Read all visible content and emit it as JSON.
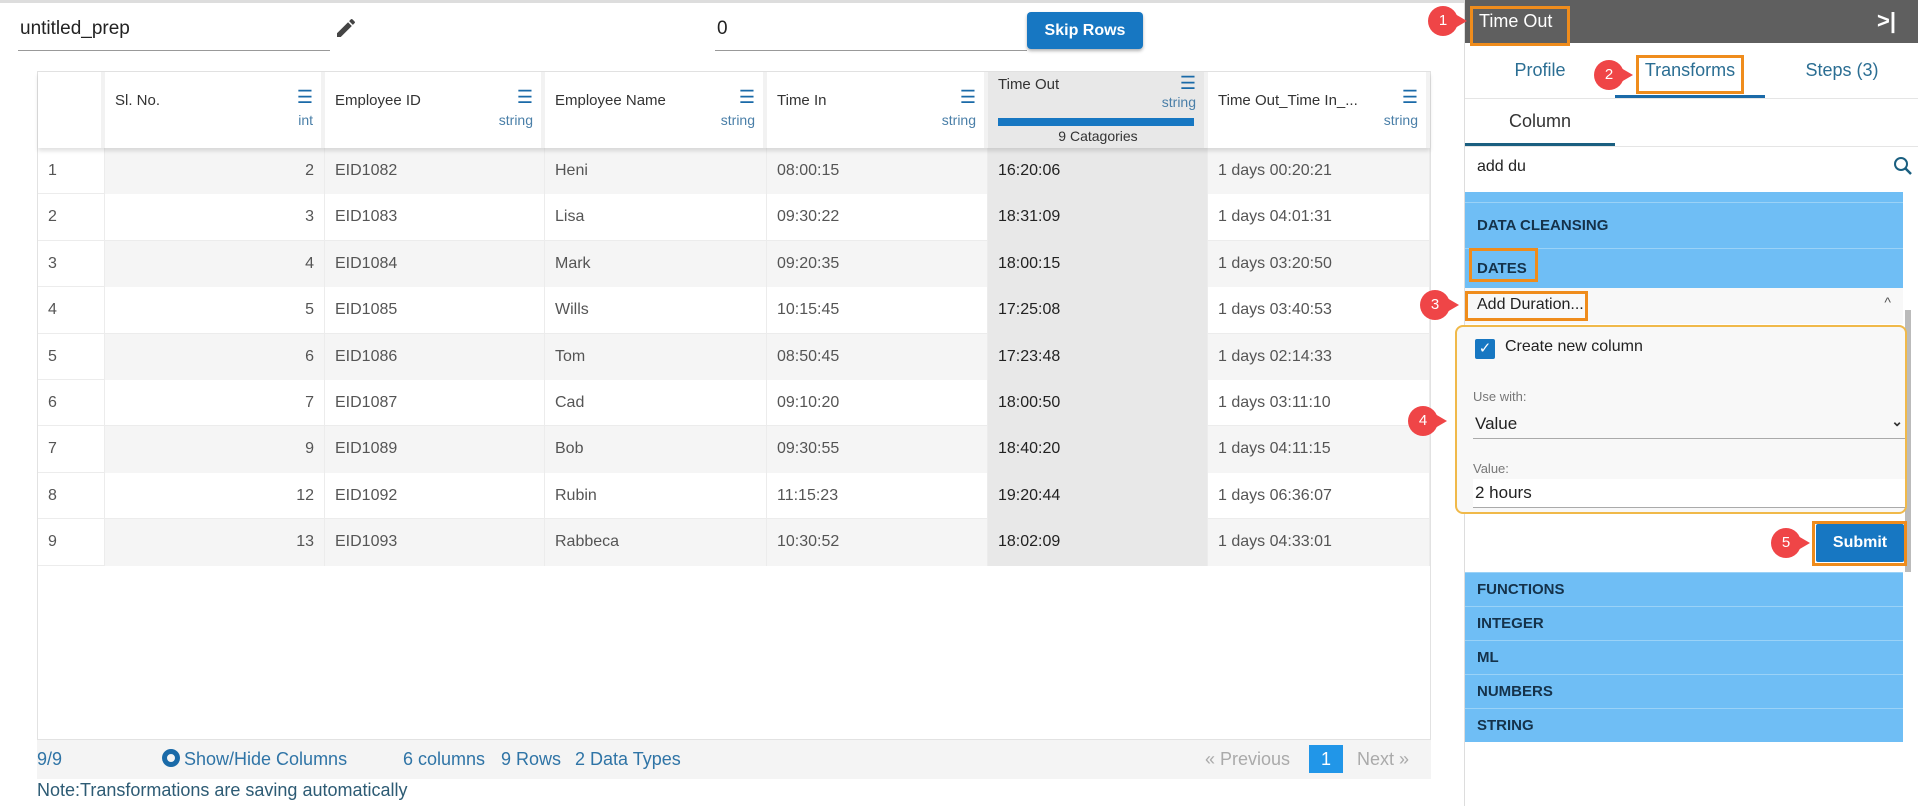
{
  "top": {
    "title_value": "untitled_prep",
    "skip_value": "0",
    "skip_button": "Skip Rows"
  },
  "table": {
    "columns": [
      {
        "label": "Sl. No.",
        "type": "int"
      },
      {
        "label": "Employee ID",
        "type": "string"
      },
      {
        "label": "Employee Name",
        "type": "string"
      },
      {
        "label": "Time In",
        "type": "string"
      },
      {
        "label": "Time Out",
        "type": "string",
        "categories": "9 Catagories"
      },
      {
        "label": "Time Out_Time In_...",
        "type": "string"
      }
    ],
    "rows": [
      [
        "1",
        "2",
        "EID1082",
        "Heni",
        "08:00:15",
        "16:20:06",
        "1 days 00:20:21"
      ],
      [
        "2",
        "3",
        "EID1083",
        "Lisa",
        "09:30:22",
        "18:31:09",
        "1 days 04:01:31"
      ],
      [
        "3",
        "4",
        "EID1084",
        "Mark",
        "09:20:35",
        "18:00:15",
        "1 days 03:20:50"
      ],
      [
        "4",
        "5",
        "EID1085",
        "Wills",
        "10:15:45",
        "17:25:08",
        "1 days 03:40:53"
      ],
      [
        "5",
        "6",
        "EID1086",
        "Tom",
        "08:50:45",
        "17:23:48",
        "1 days 02:14:33"
      ],
      [
        "6",
        "7",
        "EID1087",
        "Cad",
        "09:10:20",
        "18:00:50",
        "1 days 03:11:10"
      ],
      [
        "7",
        "9",
        "EID1089",
        "Bob",
        "09:30:55",
        "18:40:20",
        "1 days 04:11:15"
      ],
      [
        "8",
        "12",
        "EID1092",
        "Rubin",
        "11:15:23",
        "19:20:44",
        "1 days 06:36:07"
      ],
      [
        "9",
        "13",
        "EID1093",
        "Rabbeca",
        "10:30:52",
        "18:02:09",
        "1 days 04:33:01"
      ]
    ]
  },
  "footer": {
    "count": "9/9",
    "show_hide": "Show/Hide Columns",
    "columns": "6 columns",
    "rows": "9 Rows",
    "types": "2 Data Types",
    "previous": "« Previous",
    "page": "1",
    "next": "Next »"
  },
  "note": "Note:Transformations are saving automatically",
  "panel": {
    "title": "Time Out",
    "collapse_icon": "collapse-right-icon",
    "tabs": [
      "Profile",
      "Transforms",
      "Steps (3)"
    ],
    "subtab": "Column",
    "search_value": "add du",
    "categories_top": [
      "DATA CLEANSING",
      "DATES"
    ],
    "transform": "Add Duration...",
    "create_new_column": "Create new column",
    "create_checked": true,
    "use_with_label": "Use with:",
    "use_with_value": "Value",
    "value_label": "Value:",
    "value_value": "2 hours",
    "submit": "Submit",
    "categories_bottom": [
      "FUNCTIONS",
      "INTEGER",
      "ML",
      "NUMBERS",
      "STRING"
    ]
  },
  "annotations": [
    "1",
    "2",
    "3",
    "4",
    "5"
  ],
  "colors": {
    "accent": "#1777c2",
    "category": "#6fbef5",
    "callout": "#ef4547",
    "highlight": "#ef8c1c",
    "header": "#5f5f5f"
  }
}
